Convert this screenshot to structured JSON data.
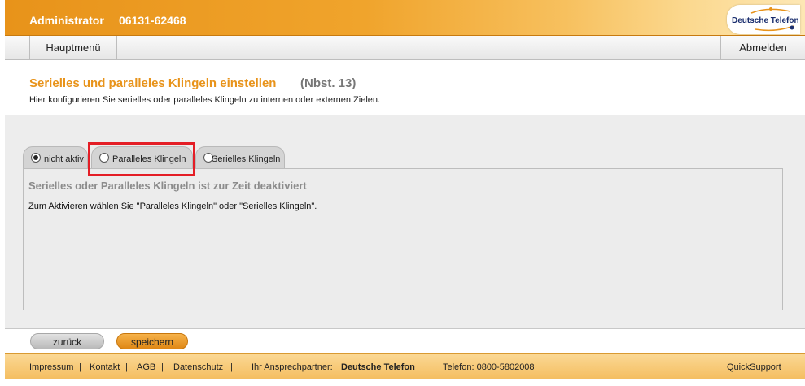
{
  "header": {
    "user_role": "Administrator",
    "phone_number": "06131-62468",
    "logo_text": "Deutsche Telefon"
  },
  "nav": {
    "main_menu_label": "Hauptmenü",
    "logout_label": "Abmelden"
  },
  "page": {
    "title": "Serielles und paralleles Klingeln einstellen",
    "extension": "(Nbst. 13)",
    "description": "Hier konfigurieren Sie serielles oder paralleles Klingeln zu internen oder externen Zielen."
  },
  "tabs": [
    {
      "label": "nicht aktiv",
      "checked": true
    },
    {
      "label": "Paralleles Klingeln",
      "checked": false
    },
    {
      "label": "Serielles Klingeln",
      "checked": false
    }
  ],
  "panel": {
    "heading": "Serielles oder Paralleles Klingeln ist zur Zeit deaktiviert",
    "text": "Zum Aktivieren wählen Sie \"Paralleles Klingeln\" oder \"Serielles Klingeln\"."
  },
  "buttons": {
    "back_label": "zurück",
    "save_label": "speichern"
  },
  "footer": {
    "impressum": "Impressum",
    "kontakt": "Kontakt",
    "agb": "AGB",
    "datenschutz": "Datenschutz",
    "separator": "|",
    "partner_label": "Ihr Ansprechpartner:",
    "partner_name": "Deutsche Telefon",
    "phone_label": "Telefon: 0800-5802008",
    "quicksupport": "QuickSupport"
  },
  "colors": {
    "accent_orange": "#e8931a",
    "highlight_red": "#e41e26",
    "logo_blue": "#1a2e6e"
  }
}
